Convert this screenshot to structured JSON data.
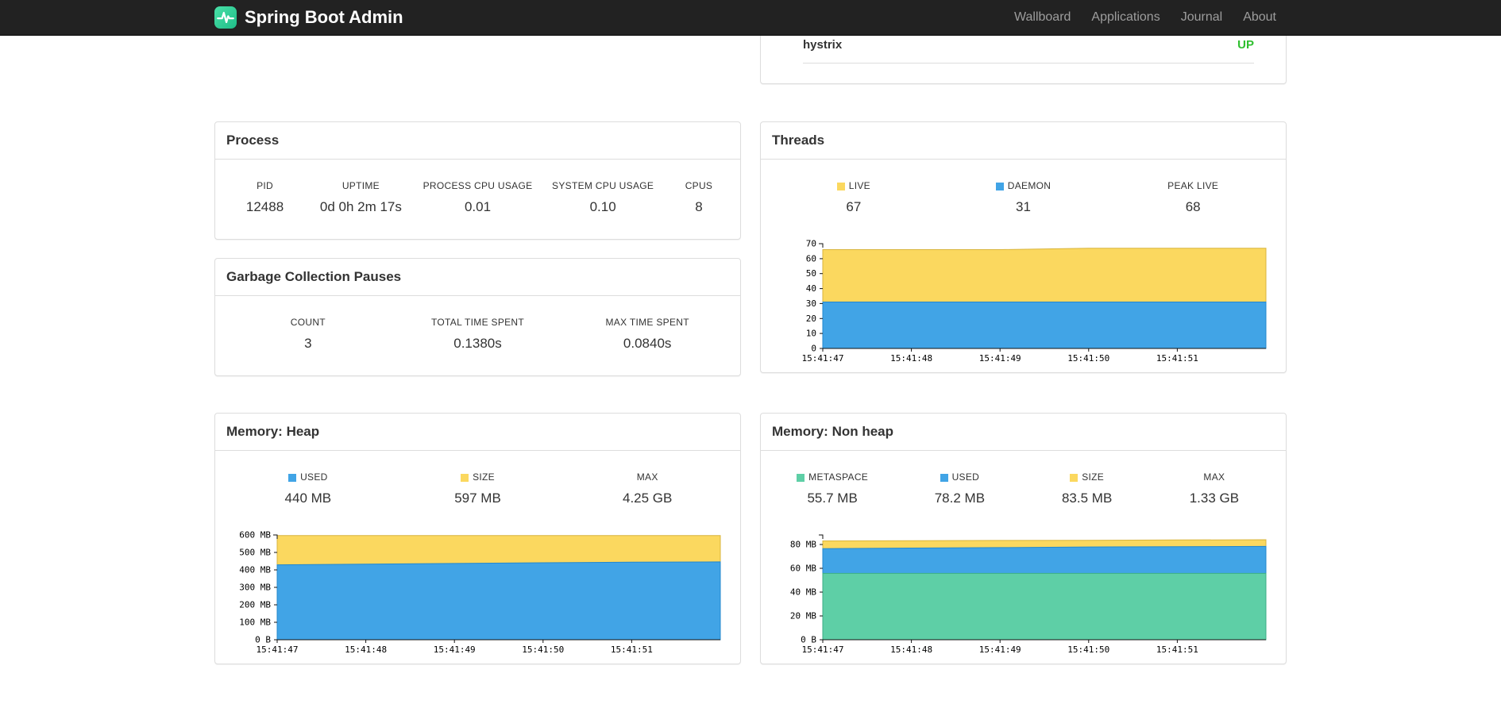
{
  "navbar": {
    "brand": "Spring Boot Admin",
    "items": [
      {
        "label": "Wallboard"
      },
      {
        "label": "Applications"
      },
      {
        "label": "Journal"
      },
      {
        "label": "About"
      }
    ]
  },
  "health": {
    "row_label": "hystrix",
    "row_status": "UP",
    "status_color": "#2fbf2f"
  },
  "process": {
    "title": "Process",
    "stats": [
      {
        "label": "PID",
        "value": "12488"
      },
      {
        "label": "UPTIME",
        "value": "0d 0h 2m 17s"
      },
      {
        "label": "PROCESS CPU USAGE",
        "value": "0.01"
      },
      {
        "label": "SYSTEM CPU USAGE",
        "value": "0.10"
      },
      {
        "label": "CPUS",
        "value": "8"
      }
    ]
  },
  "gc": {
    "title": "Garbage Collection Pauses",
    "stats": [
      {
        "label": "COUNT",
        "value": "3"
      },
      {
        "label": "TOTAL TIME SPENT",
        "value": "0.1380s"
      },
      {
        "label": "MAX TIME SPENT",
        "value": "0.0840s"
      }
    ]
  },
  "threads": {
    "title": "Threads",
    "stats": [
      {
        "label": "LIVE",
        "value": "67",
        "color": "#fbd85f"
      },
      {
        "label": "DAEMON",
        "value": "31",
        "color": "#41a4e6"
      },
      {
        "label": "PEAK LIVE",
        "value": "68"
      }
    ]
  },
  "heap": {
    "title": "Memory: Heap",
    "stats": [
      {
        "label": "USED",
        "value": "440 MB",
        "color": "#41a4e6"
      },
      {
        "label": "SIZE",
        "value": "597 MB",
        "color": "#fbd85f"
      },
      {
        "label": "MAX",
        "value": "4.25 GB"
      }
    ]
  },
  "nonheap": {
    "title": "Memory: Non heap",
    "stats": [
      {
        "label": "METASPACE",
        "value": "55.7 MB",
        "color": "#5ecfa6"
      },
      {
        "label": "USED",
        "value": "78.2 MB",
        "color": "#41a4e6"
      },
      {
        "label": "SIZE",
        "value": "83.5 MB",
        "color": "#fbd85f"
      },
      {
        "label": "MAX",
        "value": "1.33 GB"
      }
    ]
  },
  "chart_data": [
    {
      "type": "area",
      "title": "Threads",
      "x_labels": [
        "15:41:47",
        "15:41:48",
        "15:41:49",
        "15:41:50",
        "15:41:51"
      ],
      "ymax": 70,
      "yticks": [
        [
          0,
          "0"
        ],
        [
          10,
          "10"
        ],
        [
          20,
          "20"
        ],
        [
          30,
          "30"
        ],
        [
          40,
          "40"
        ],
        [
          50,
          "50"
        ],
        [
          60,
          "60"
        ],
        [
          70,
          "70"
        ]
      ],
      "legend_position": "top",
      "grid": false,
      "series": [
        {
          "name": "LIVE",
          "fill": "#fbd85f",
          "stroke": "#d8b43c",
          "values": [
            66,
            66,
            66,
            67,
            67,
            67
          ]
        },
        {
          "name": "DAEMON",
          "fill": "#41a4e6",
          "stroke": "#2488cd",
          "values": [
            31,
            31,
            31,
            31,
            31,
            31
          ]
        }
      ]
    },
    {
      "type": "area",
      "title": "Memory: Heap",
      "x_labels": [
        "15:41:47",
        "15:41:48",
        "15:41:49",
        "15:41:50",
        "15:41:51"
      ],
      "ymax": 600,
      "yticks": [
        [
          0,
          "0 B"
        ],
        [
          100,
          "100 MB"
        ],
        [
          200,
          "200 MB"
        ],
        [
          300,
          "300 MB"
        ],
        [
          400,
          "400 MB"
        ],
        [
          500,
          "500 MB"
        ],
        [
          600,
          "600 MB"
        ]
      ],
      "legend_position": "top",
      "grid": false,
      "series": [
        {
          "name": "SIZE",
          "fill": "#fbd85f",
          "stroke": "#d8b43c",
          "values": [
            597,
            597,
            597,
            597,
            597,
            597
          ]
        },
        {
          "name": "USED",
          "fill": "#41a4e6",
          "stroke": "#2488cd",
          "values": [
            429,
            433,
            437,
            441,
            444,
            446
          ]
        }
      ]
    },
    {
      "type": "area",
      "title": "Memory: Non heap",
      "x_labels": [
        "15:41:47",
        "15:41:48",
        "15:41:49",
        "15:41:50",
        "15:41:51"
      ],
      "ymax": 88,
      "yticks": [
        [
          0,
          "0 B"
        ],
        [
          20,
          "20 MB"
        ],
        [
          40,
          "40 MB"
        ],
        [
          60,
          "60 MB"
        ],
        [
          80,
          "80 MB"
        ]
      ],
      "legend_position": "top",
      "grid": false,
      "series": [
        {
          "name": "SIZE",
          "fill": "#fbd85f",
          "stroke": "#d8b43c",
          "values": [
            83,
            83.2,
            83.4,
            83.5,
            83.8,
            84
          ]
        },
        {
          "name": "USED",
          "fill": "#41a4e6",
          "stroke": "#2488cd",
          "values": [
            76.5,
            77,
            77.4,
            77.9,
            78.2,
            78.4
          ]
        },
        {
          "name": "METASPACE",
          "fill": "#5ecfa6",
          "stroke": "#3cae85",
          "values": [
            55.7,
            55.7,
            55.7,
            55.7,
            55.7,
            55.7
          ]
        }
      ]
    }
  ]
}
